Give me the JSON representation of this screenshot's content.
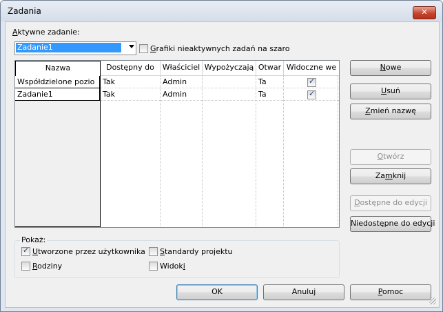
{
  "window": {
    "title": "Zadania",
    "close_glyph": "✕"
  },
  "active_task": {
    "label_prefix": "",
    "label_underlined": "A",
    "label_rest": "ktywne zadanie:",
    "value": "Zadanie1"
  },
  "gray_inactive": {
    "underlined": "G",
    "rest": "rafiki nieaktywnych zadań na szaro",
    "checked": false
  },
  "grid": {
    "columns": [
      "Nazwa",
      "Dostępny do",
      "Właściciel",
      "Wypożyczają",
      "Otwar",
      "Widoczne we"
    ],
    "rows": [
      {
        "name": "Współdzielone pozio",
        "available": "Tak",
        "owner": "Admin",
        "borrowed": "",
        "open": "Ta",
        "visible": true
      },
      {
        "name": "Zadanie1",
        "available": "Tak",
        "owner": "Admin",
        "borrowed": "",
        "open": "Ta",
        "visible": true
      }
    ]
  },
  "buttons": {
    "new": {
      "u": "N",
      "rest": "owe",
      "pre": ""
    },
    "delete": {
      "pre": "",
      "u": "U",
      "rest": "suń"
    },
    "rename": {
      "pre": "",
      "u": "Z",
      "rest": "mień nazwę"
    },
    "open": {
      "pre": "",
      "u": "O",
      "rest": "twórz"
    },
    "close": {
      "pre": "Za",
      "u": "m",
      "rest": "knij"
    },
    "editable": {
      "pre": "",
      "u": "D",
      "rest": "ostępne do edycji"
    },
    "non_editable": {
      "pre": "Niedostępne do edycji",
      "u": "",
      "rest": ""
    },
    "ok": "OK",
    "cancel": "Anuluj",
    "help": {
      "pre": "",
      "u": "P",
      "rest": "omoc"
    }
  },
  "show": {
    "title": "Pokaż:",
    "user_created": {
      "pre": "",
      "u": "U",
      "rest": "tworzone przez użytkownika",
      "checked": true
    },
    "families": {
      "pre": "",
      "u": "R",
      "rest": "odziny",
      "checked": false
    },
    "project_standards": {
      "pre": "",
      "u": "S",
      "rest": "tandardy projektu",
      "checked": false
    },
    "views": {
      "pre": "Widok",
      "u": "i",
      "rest": "",
      "checked": false
    }
  }
}
